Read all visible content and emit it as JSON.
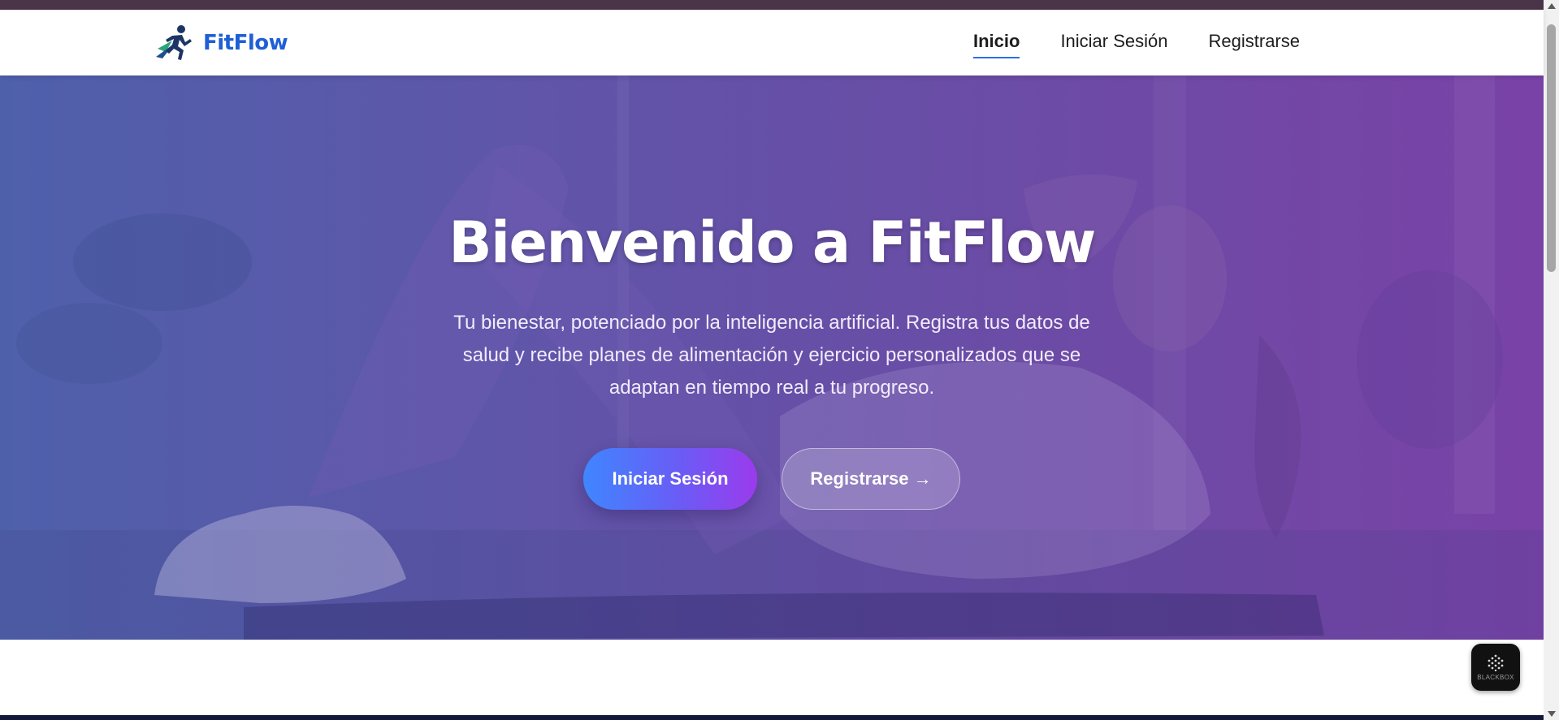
{
  "brand": {
    "name": "FitFlow",
    "logo_icon": "running-figure-icon"
  },
  "nav": {
    "items": [
      {
        "label": "Inicio",
        "active": true
      },
      {
        "label": "Iniciar Sesión",
        "active": false
      },
      {
        "label": "Registrarse",
        "active": false
      }
    ]
  },
  "hero": {
    "title": "Bienvenido a FitFlow",
    "subtitle": "Tu bienestar, potenciado por la inteligencia artificial. Registra tus datos de salud y recibe planes de alimentación y ejercicio personalizados que se adaptan en tiempo real a tu progreso.",
    "primary_button": "Iniciar Sesión",
    "secondary_button": "Registrarse →"
  },
  "widget": {
    "label": "BLACKBOX",
    "icon": "blackbox-dots-icon"
  },
  "colors": {
    "brand_blue": "#1f5fd6",
    "hero_gradient_start": "#5463ab",
    "hero_gradient_end": "#7a45a5",
    "primary_button_start": "#3f86ff",
    "primary_button_end": "#9b3bed"
  }
}
